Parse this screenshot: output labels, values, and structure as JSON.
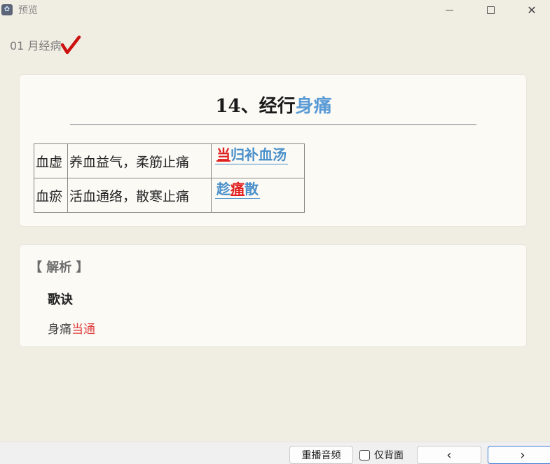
{
  "window": {
    "title": "预览",
    "app_icon": "app-icon",
    "controls": {
      "minimize": "minimize-icon",
      "maximize": "maximize-icon",
      "close": "✕"
    }
  },
  "deck": {
    "label": "01 月经病",
    "mark": "check-icon",
    "mark_color": "#cc1111"
  },
  "card": {
    "title_prefix": "14、经行",
    "title_highlight": "身痛",
    "rows": [
      {
        "syndrome": "血虚",
        "method": "养血益气，柔筋止痛",
        "formula": [
          {
            "text": "当",
            "red": true
          },
          {
            "text": "归补血汤",
            "red": false
          }
        ]
      },
      {
        "syndrome": "血瘀",
        "method": "活血通络，散寒止痛",
        "formula": [
          {
            "text": "趁",
            "red": false
          },
          {
            "text": "痛",
            "red": true
          },
          {
            "text": "散",
            "red": false
          }
        ]
      }
    ]
  },
  "analysis": {
    "header": "【 解析 】",
    "song_label": "歌诀",
    "song_plain": "身痛",
    "song_red": "当通"
  },
  "footer": {
    "replay_label": "重播音频",
    "backonly_label": "仅背面",
    "backonly_checked": false,
    "prev_label": "‹",
    "next_label": "›"
  },
  "colors": {
    "background": "#f0eee3",
    "card": "#fbfaf5",
    "highlight_blue": "#5b9bd5",
    "formula_blue": "#4a8fca",
    "red": "#e02020"
  }
}
